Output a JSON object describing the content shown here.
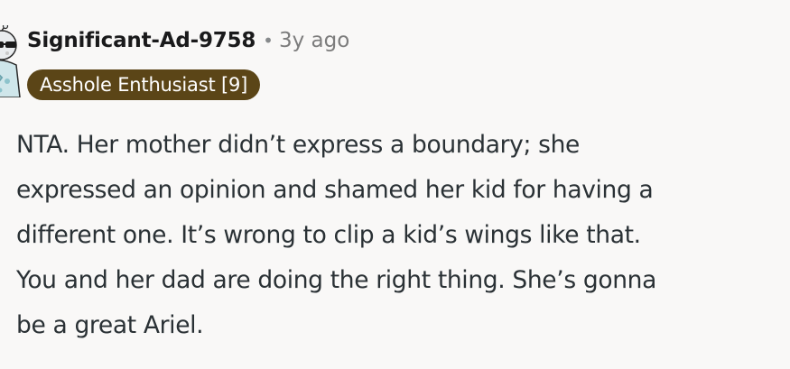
{
  "comment": {
    "author": "Significant-Ad-9758",
    "separator": "•",
    "timestamp": "3y ago",
    "flair": "Asshole Enthusiast [9]",
    "flair_color": "#5b4517",
    "avatar_icon": "snoo-avatar-icon",
    "body_lines": [
      "NTA. Her mother didn’t express a boundary; she",
      "expressed an opinion and shamed her kid for having a",
      "different one. It’s wrong to clip a kid’s wings like that.",
      "You and her dad are doing the right thing. She’s gonna",
      "be a great Ariel."
    ]
  }
}
